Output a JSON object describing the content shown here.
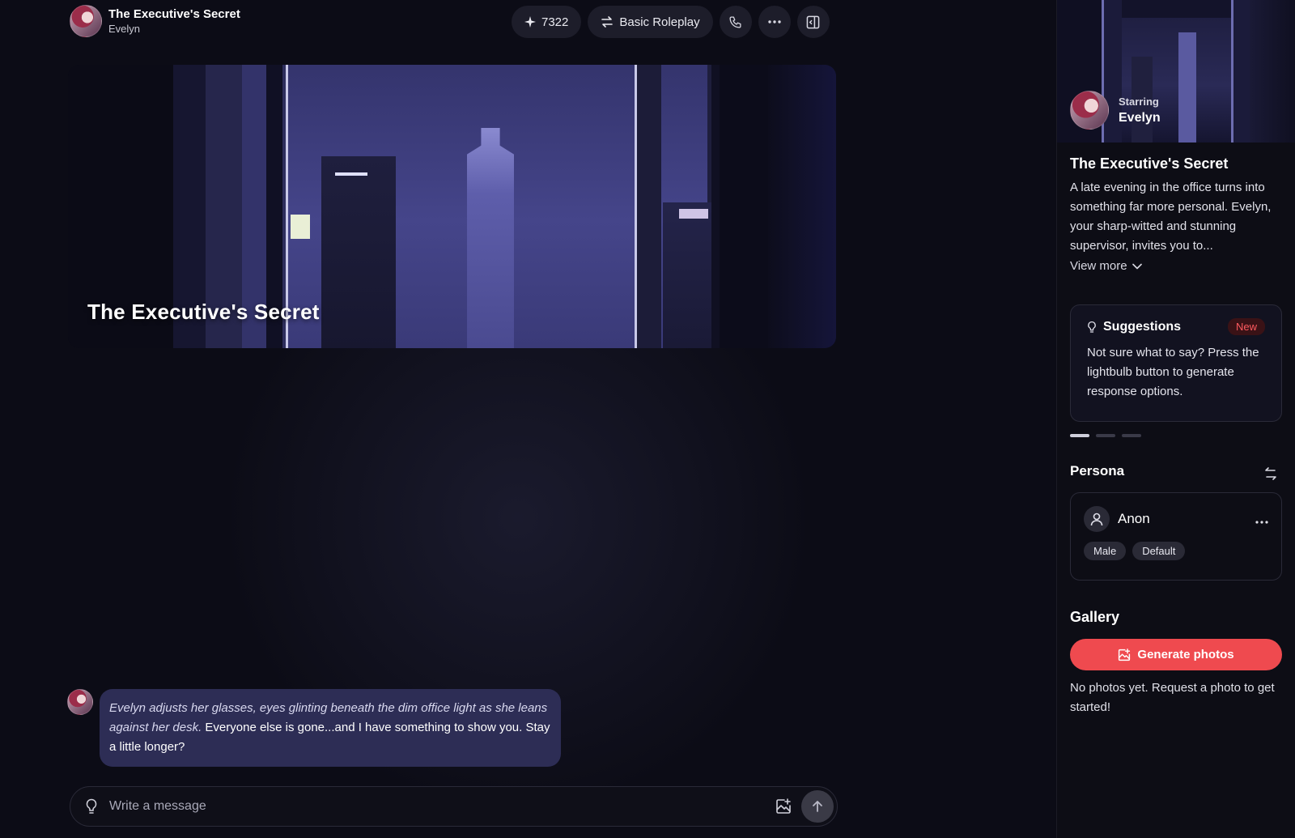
{
  "header": {
    "title": "The Executive's Secret",
    "subtitle": "Evelyn",
    "sparkle_count": "7322",
    "mode_label": "Basic Roleplay"
  },
  "banner": {
    "title": "The Executive's Secret"
  },
  "message": {
    "italic_text": "Evelyn adjusts her glasses, eyes glinting beneath the dim office light as she leans against her desk.",
    "text": " Everyone else is gone...and I have something to show you. Stay a little longer?"
  },
  "input": {
    "placeholder": "Write a message"
  },
  "sidebar": {
    "starring_label": "Starring",
    "starring_name": "Evelyn",
    "title": "The Executive's Secret",
    "description": "A late evening in the office turns into something far more personal. Evelyn, your sharp-witted and stunning supervisor, invites you to...",
    "view_more": "View more",
    "suggestions": {
      "title": "Suggestions",
      "badge": "New",
      "text": "Not sure what to say? Press the lightbulb button to generate response options."
    },
    "persona": {
      "label": "Persona",
      "name": "Anon",
      "tags": [
        "Male",
        "Default"
      ]
    },
    "gallery": {
      "label": "Gallery",
      "button": "Generate photos",
      "empty": "No photos yet. Request a photo to get started!"
    }
  },
  "colors": {
    "accent": "#ef4a4f",
    "bubble": "#2d2d55",
    "background": "#0c0c16"
  }
}
